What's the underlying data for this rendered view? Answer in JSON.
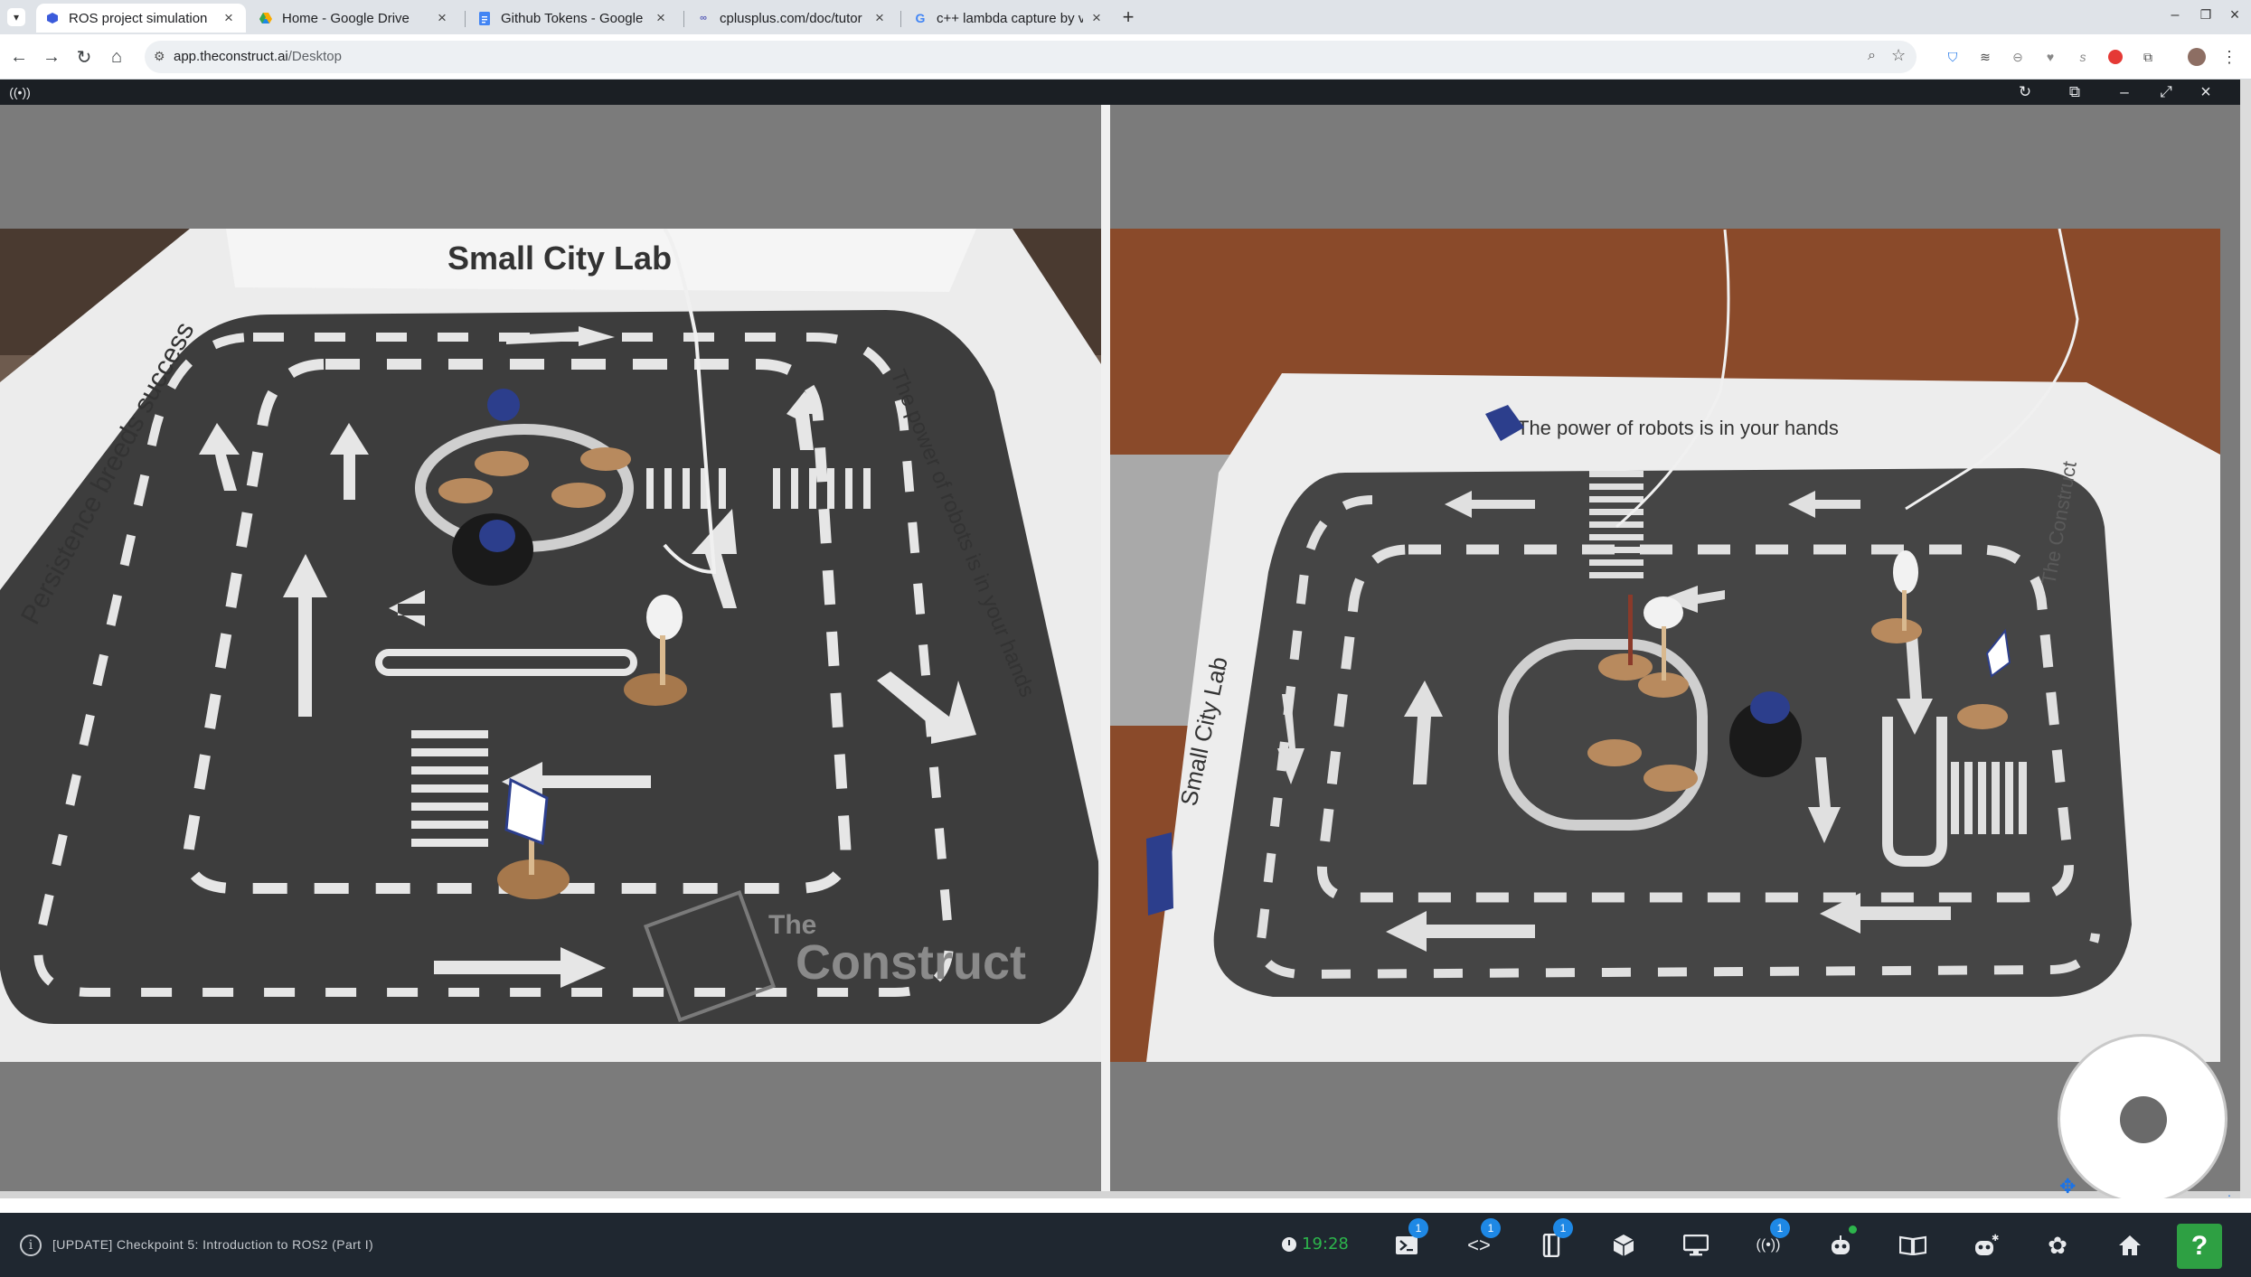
{
  "browser": {
    "tabs": [
      {
        "title": "ROS project simulation",
        "active": true,
        "icon": "construct-icon"
      },
      {
        "title": "Home - Google Drive",
        "active": false,
        "icon": "drive-icon"
      },
      {
        "title": "Github Tokens - Google D",
        "active": false,
        "icon": "docs-icon"
      },
      {
        "title": "cplusplus.com/doc/tutor",
        "active": false,
        "icon": "cplusplus-icon"
      },
      {
        "title": "c++ lambda capture by v",
        "active": false,
        "icon": "google-icon"
      }
    ],
    "new_tab_label": "+",
    "url_host": "app.theconstruct.ai",
    "url_path": "/Desktop"
  },
  "video": {
    "left_feed": {
      "banner_text": "Small City Lab",
      "left_wall_text": "Persistence  breeds success",
      "right_wall_text": "The power of robots is in your hands",
      "logo_text_1": "The",
      "logo_text_2": "Construct"
    },
    "right_feed": {
      "banner_text": "The power of robots is in your hands",
      "left_wall_text": "Small City Lab",
      "right_wall_text": "The Construct"
    }
  },
  "statusbar": {
    "course_title": "[UPDATE] Checkpoint 5: Introduction to ROS2 (Part I)",
    "timer": "19:28",
    "badges": {
      "terminal": "1",
      "code": "1",
      "notebook": "1",
      "ros": "1"
    },
    "help_label": "?"
  },
  "colors": {
    "brand_dark": "#1f2730",
    "timer_green": "#2db54c",
    "badge_blue": "#1e88e5",
    "help_green": "#2ea043"
  }
}
